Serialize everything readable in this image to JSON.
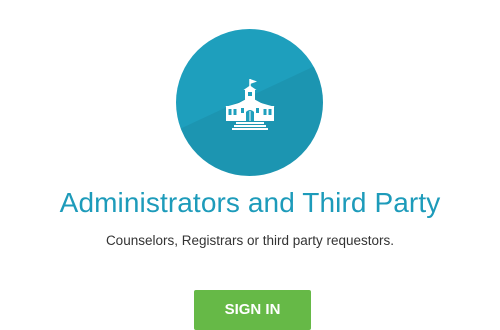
{
  "card": {
    "icon": "school-building-icon",
    "title": "Administrators and Third Party",
    "subtitle": "Counselors, Registrars or third party requestors.",
    "signin_label": "SIGN IN"
  },
  "colors": {
    "badge": "#1e9fbd",
    "title": "#1d9bba",
    "button": "#66b947",
    "subtitle": "#333333"
  }
}
